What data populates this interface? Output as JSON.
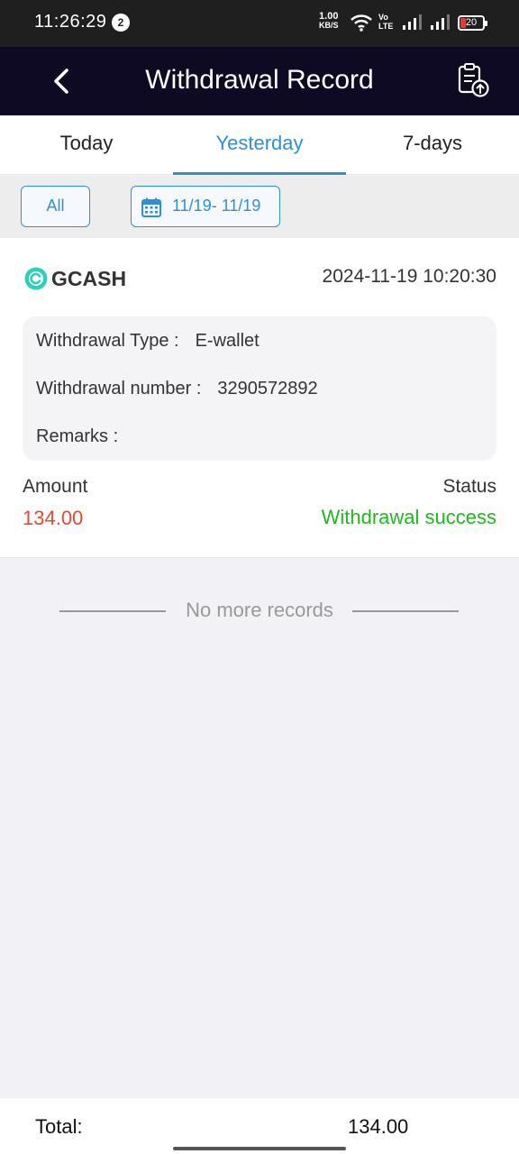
{
  "status_bar": {
    "time": "11:26:29",
    "notification_count": "2",
    "net_speed_value": "1.00",
    "net_speed_unit": "KB/S",
    "volte_top": "Vo",
    "volte_bottom": "LTE",
    "battery": "20"
  },
  "header": {
    "title": "Withdrawal Record",
    "back_icon": "chevron-left-icon",
    "action_icon": "clipboard-upload-icon"
  },
  "tabs": [
    {
      "label": "Today",
      "active": false
    },
    {
      "label": "Yesterday",
      "active": true
    },
    {
      "label": "7-days",
      "active": false
    }
  ],
  "filters": {
    "all_label": "All",
    "date_range": "11/19- 11/19",
    "date_icon": "calendar-icon"
  },
  "record": {
    "brand": "GCASH",
    "datetime": "2024-11-19 10:20:30",
    "withdrawal_type_label": "Withdrawal Type :",
    "withdrawal_type_value": "E-wallet",
    "withdrawal_number_label": "Withdrawal number :",
    "withdrawal_number_value": "3290572892",
    "remarks_label": "Remarks :",
    "remarks_value": "",
    "amount_label": "Amount",
    "amount_value": "134.00",
    "status_label": "Status",
    "status_value": "Withdrawal success"
  },
  "list_end_text": "No more records",
  "footer": {
    "total_label": "Total:",
    "total_value": "134.00"
  },
  "colors": {
    "accent": "#2e90d6",
    "header_bg": "#0e0a24",
    "amount": "#e34a2f",
    "success": "#1fb81f"
  }
}
